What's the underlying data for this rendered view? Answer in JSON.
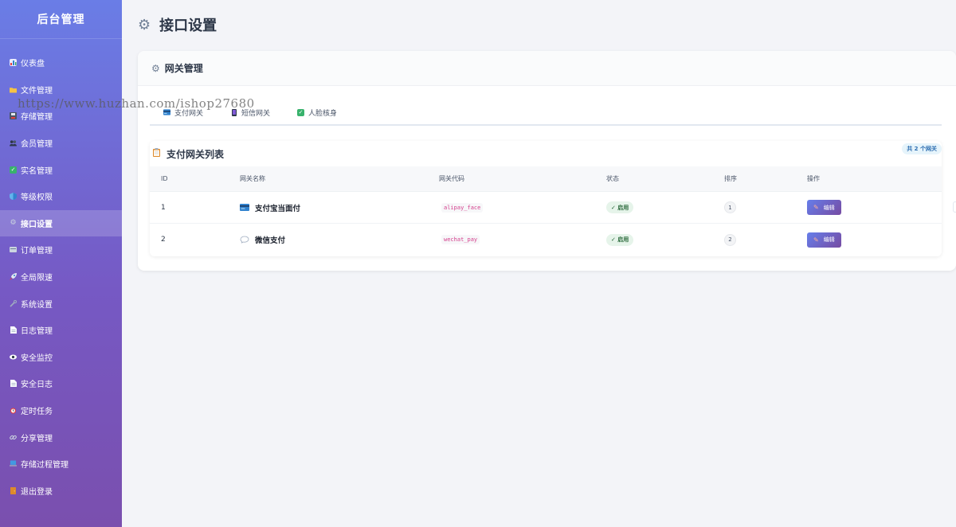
{
  "brand": "后台管理",
  "sidebar": {
    "items": [
      {
        "label": "仪表盘",
        "icon": "dashboard-icon"
      },
      {
        "label": "文件管理",
        "icon": "folder-icon"
      },
      {
        "label": "存储管理",
        "icon": "floppy-disk-icon"
      },
      {
        "label": "会员管理",
        "icon": "users-icon"
      },
      {
        "label": "实名管理",
        "icon": "check-box-icon"
      },
      {
        "label": "等级权限",
        "icon": "shield-icon"
      },
      {
        "label": "接口设置",
        "icon": "gear-icon",
        "active": true
      },
      {
        "label": "订单管理",
        "icon": "receipt-icon"
      },
      {
        "label": "全局限速",
        "icon": "rocket-icon"
      },
      {
        "label": "系统设置",
        "icon": "wrench-icon"
      },
      {
        "label": "日志管理",
        "icon": "document-icon"
      },
      {
        "label": "安全监控",
        "icon": "eye-icon"
      },
      {
        "label": "安全日志",
        "icon": "document-icon"
      },
      {
        "label": "定时任务",
        "icon": "alarm-clock-icon"
      },
      {
        "label": "分享管理",
        "icon": "link-icon"
      },
      {
        "label": "存储过程管理",
        "icon": "computer-icon"
      },
      {
        "label": "退出登录",
        "icon": "door-icon"
      }
    ]
  },
  "page": {
    "title": "接口设置"
  },
  "card": {
    "title": "网关管理"
  },
  "tabs": [
    {
      "label": "支付网关",
      "icon": "credit-card-icon"
    },
    {
      "label": "短信网关",
      "icon": "phone-icon"
    },
    {
      "label": "人脸核身",
      "icon": "check-box-icon"
    }
  ],
  "list": {
    "title": "支付网关列表",
    "count_badge": "共 2 个网关",
    "columns": {
      "id": "ID",
      "name": "网关名称",
      "code": "网关代码",
      "status": "状态",
      "sort": "排序",
      "ops": "操作"
    },
    "rows": [
      {
        "id": "1",
        "name": "支付宝当面付",
        "icon": "credit-card-icon",
        "code": "alipay_face",
        "status": "✓ 启用",
        "sort": "1",
        "edit": "编辑"
      },
      {
        "id": "2",
        "name": "微信支付",
        "icon": "chat-bubble-icon",
        "code": "wechat_pay",
        "status": "✓ 启用",
        "sort": "2",
        "edit": "编辑"
      }
    ]
  },
  "watermark": "https://www.huzhan.com/ishop27680",
  "colors": {
    "accent": "#667eea",
    "accent2": "#764ba2",
    "enabled": "#276738"
  }
}
